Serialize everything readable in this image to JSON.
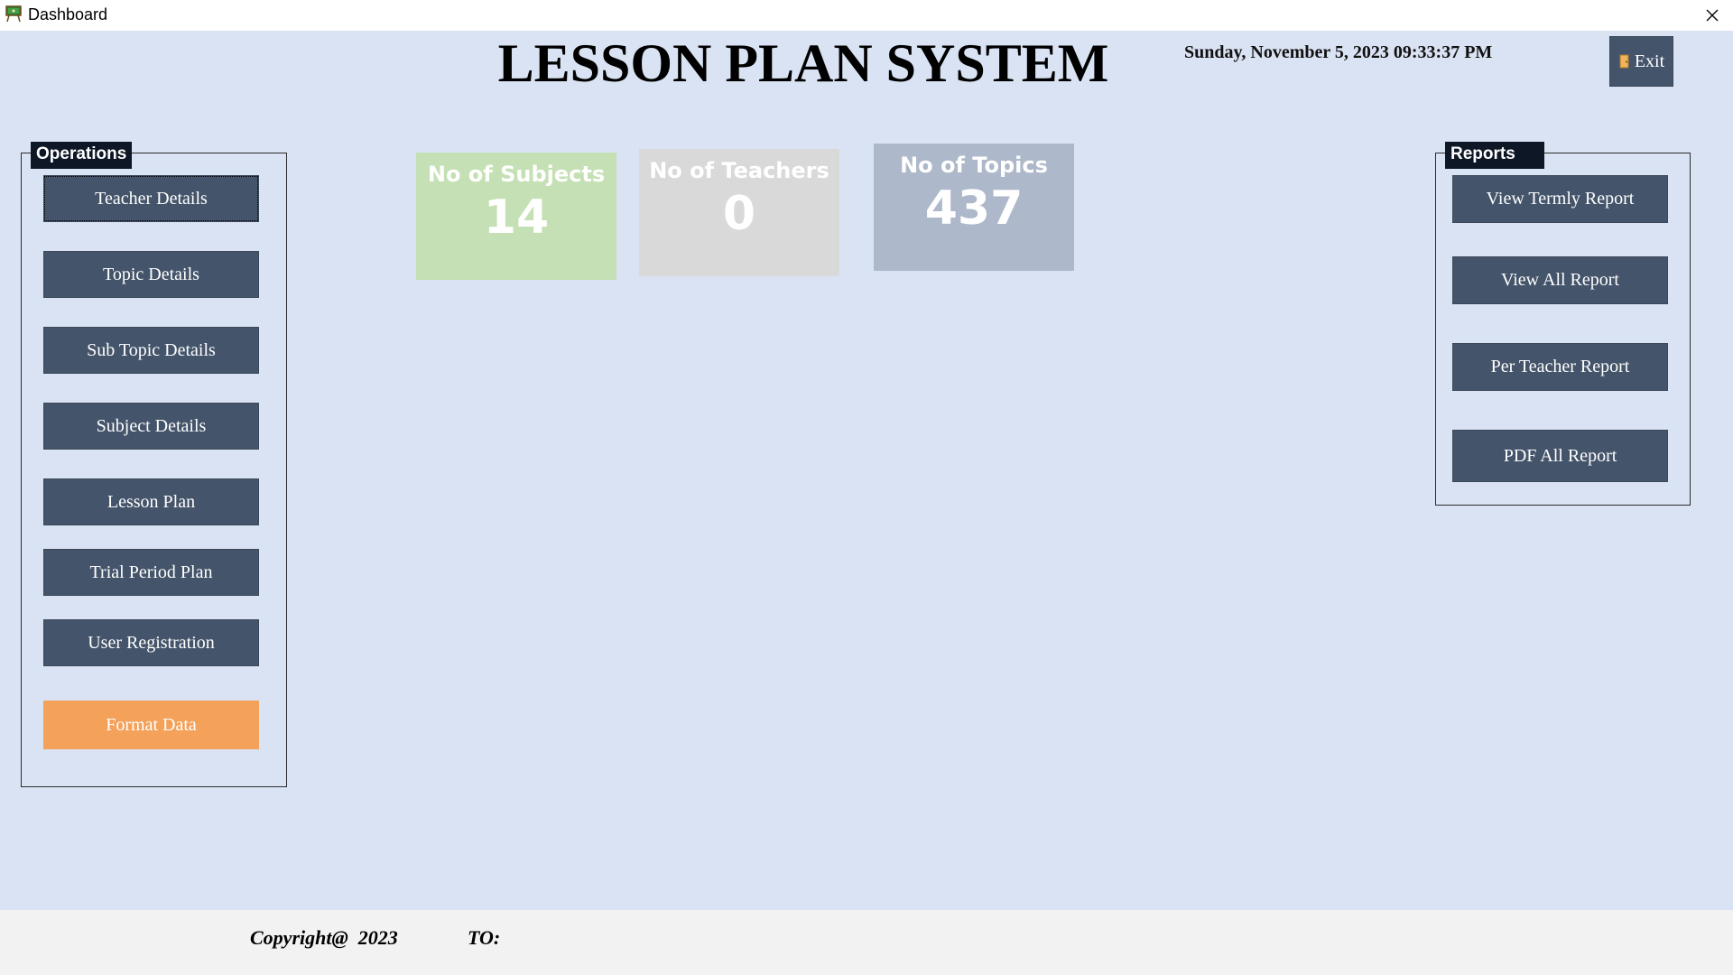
{
  "window": {
    "title": "Dashboard",
    "close_symbol": "✕"
  },
  "header": {
    "title": "LESSON PLAN SYSTEM",
    "datetime": "Sunday, November 5, 2023 09:33:37 PM",
    "exit_label": "Exit",
    "exit_icon": "door-icon"
  },
  "operations": {
    "label": "Operations",
    "buttons": [
      {
        "label": "Teacher Details"
      },
      {
        "label": "Topic Details"
      },
      {
        "label": "Sub Topic Details"
      },
      {
        "label": "Subject Details"
      },
      {
        "label": "Lesson Plan"
      },
      {
        "label": "Trial Period Plan"
      },
      {
        "label": "User Registration"
      },
      {
        "label": "Format Data"
      }
    ]
  },
  "stats": [
    {
      "label": "No of Subjects",
      "value": "14",
      "color": "#c5e0b4"
    },
    {
      "label": "No of Teachers",
      "value": "0",
      "color": "#d9d9d9"
    },
    {
      "label": "No of Topics",
      "value": "437",
      "color": "#adb9ca"
    }
  ],
  "reports": {
    "label": "Reports",
    "buttons": [
      {
        "label": "View Termly Report"
      },
      {
        "label": "View All Report"
      },
      {
        "label": "Per Teacher Report"
      },
      {
        "label": "PDF All Report"
      }
    ]
  },
  "footer": {
    "copyright": "Copyright@  2023",
    "to_label": "TO:"
  },
  "colors": {
    "background": "#dae3f3",
    "button": "#44546a",
    "accent_button": "#f4a15a",
    "group_label": "#0e1726"
  }
}
